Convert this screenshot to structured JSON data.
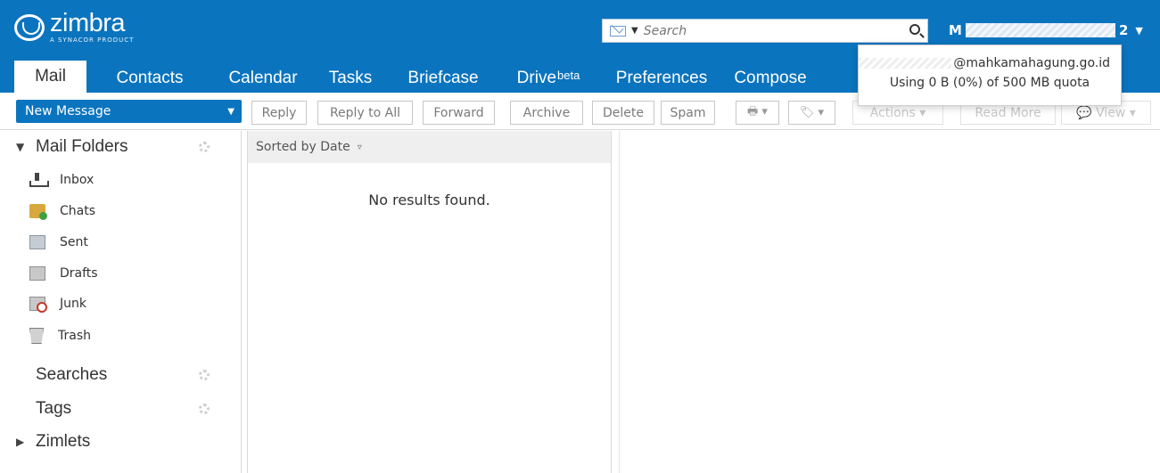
{
  "app": {
    "logo_word": "zimbra",
    "logo_sub": "A SYNACOR PRODUCT"
  },
  "header": {
    "search_placeholder": "Search",
    "user_prefix": "M",
    "user_suffix": "2"
  },
  "tabs": [
    {
      "label": "Mail",
      "active": true
    },
    {
      "label": "Contacts"
    },
    {
      "label": "Calendar"
    },
    {
      "label": "Tasks"
    },
    {
      "label": "Briefcase"
    },
    {
      "label": "Drive",
      "sup": "beta"
    },
    {
      "label": "Preferences"
    },
    {
      "label": "Compose"
    }
  ],
  "toolbar": {
    "new_message": "New Message",
    "reply": "Reply",
    "reply_all": "Reply to All",
    "forward": "Forward",
    "archive": "Archive",
    "delete": "Delete",
    "spam": "Spam",
    "actions": "Actions",
    "read_more": "Read More",
    "view": "View"
  },
  "left_pane": {
    "mail_folders": "Mail Folders",
    "folders": [
      {
        "label": "Inbox",
        "icon": "inbox-icon"
      },
      {
        "label": "Chats",
        "icon": "chats-icon"
      },
      {
        "label": "Sent",
        "icon": "sent-icon"
      },
      {
        "label": "Drafts",
        "icon": "drafts-icon"
      },
      {
        "label": "Junk",
        "icon": "junk-icon"
      },
      {
        "label": "Trash",
        "icon": "trash-icon"
      }
    ],
    "searches": "Searches",
    "tags": "Tags",
    "zimlets": "Zimlets"
  },
  "middle_pane": {
    "sort_label": "Sorted by Date",
    "empty_message": "No results found."
  },
  "quota_popup": {
    "email_domain": "@mahkamahagung.go.id",
    "quota_text": "Using 0 B (0%) of 500 MB quota"
  },
  "colors": {
    "header": "#0b74bf",
    "accent": "#0b74bf"
  }
}
